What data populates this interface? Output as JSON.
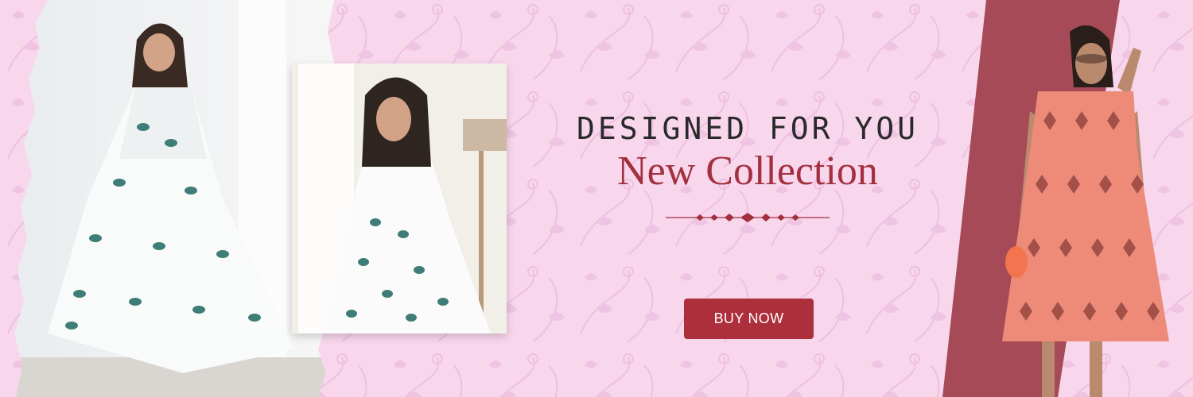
{
  "banner": {
    "tagline": "DESIGNED FOR YOU",
    "headline": "New Collection",
    "cta_label": "BUY NOW"
  },
  "colors": {
    "background": "#f8d6ec",
    "pattern": "#f0bfe0",
    "accent": "#ad2f3c",
    "band": "#a54a56",
    "tagline": "#2a2a2a",
    "headline": "#a3303e"
  },
  "images": {
    "left_photo": "model-white-floral-anarkali-dress-twirling",
    "middle_photo": "model-white-floral-anarkali-closeup",
    "right_photo": "model-coral-ikat-print-midi-dress-sunglasses"
  }
}
